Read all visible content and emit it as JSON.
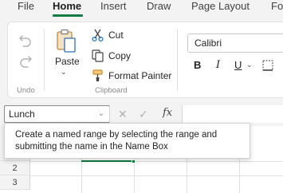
{
  "ribbon_tabs": [
    "File",
    "Home",
    "Insert",
    "Draw",
    "Page Layout",
    "Fo"
  ],
  "active_tab": "Home",
  "undo_group": {
    "caption": "Undo"
  },
  "clipboard_group": {
    "paste_label": "Paste",
    "cut_label": "Cut",
    "copy_label": "Copy",
    "format_painter_label": "Format Painter",
    "caption": "Clipboard"
  },
  "font_group": {
    "font_name": "Calibri",
    "bold_label": "B",
    "italic_label": "I",
    "underline_label": "U"
  },
  "formula_bar": {
    "name_box_value": "Lunch",
    "fx_label": "fx"
  },
  "grid": {
    "row_numbers": [
      "2",
      "3"
    ]
  },
  "tooltip": {
    "line1": "Create a named range by selecting the range and",
    "line2": "submitting the name in the Name Box"
  },
  "colors": {
    "accent": "#107c41",
    "paste_icon": "#c48a3d",
    "brush_icon": "#d18a2a",
    "scissor_icon": "#2f6fbf"
  }
}
